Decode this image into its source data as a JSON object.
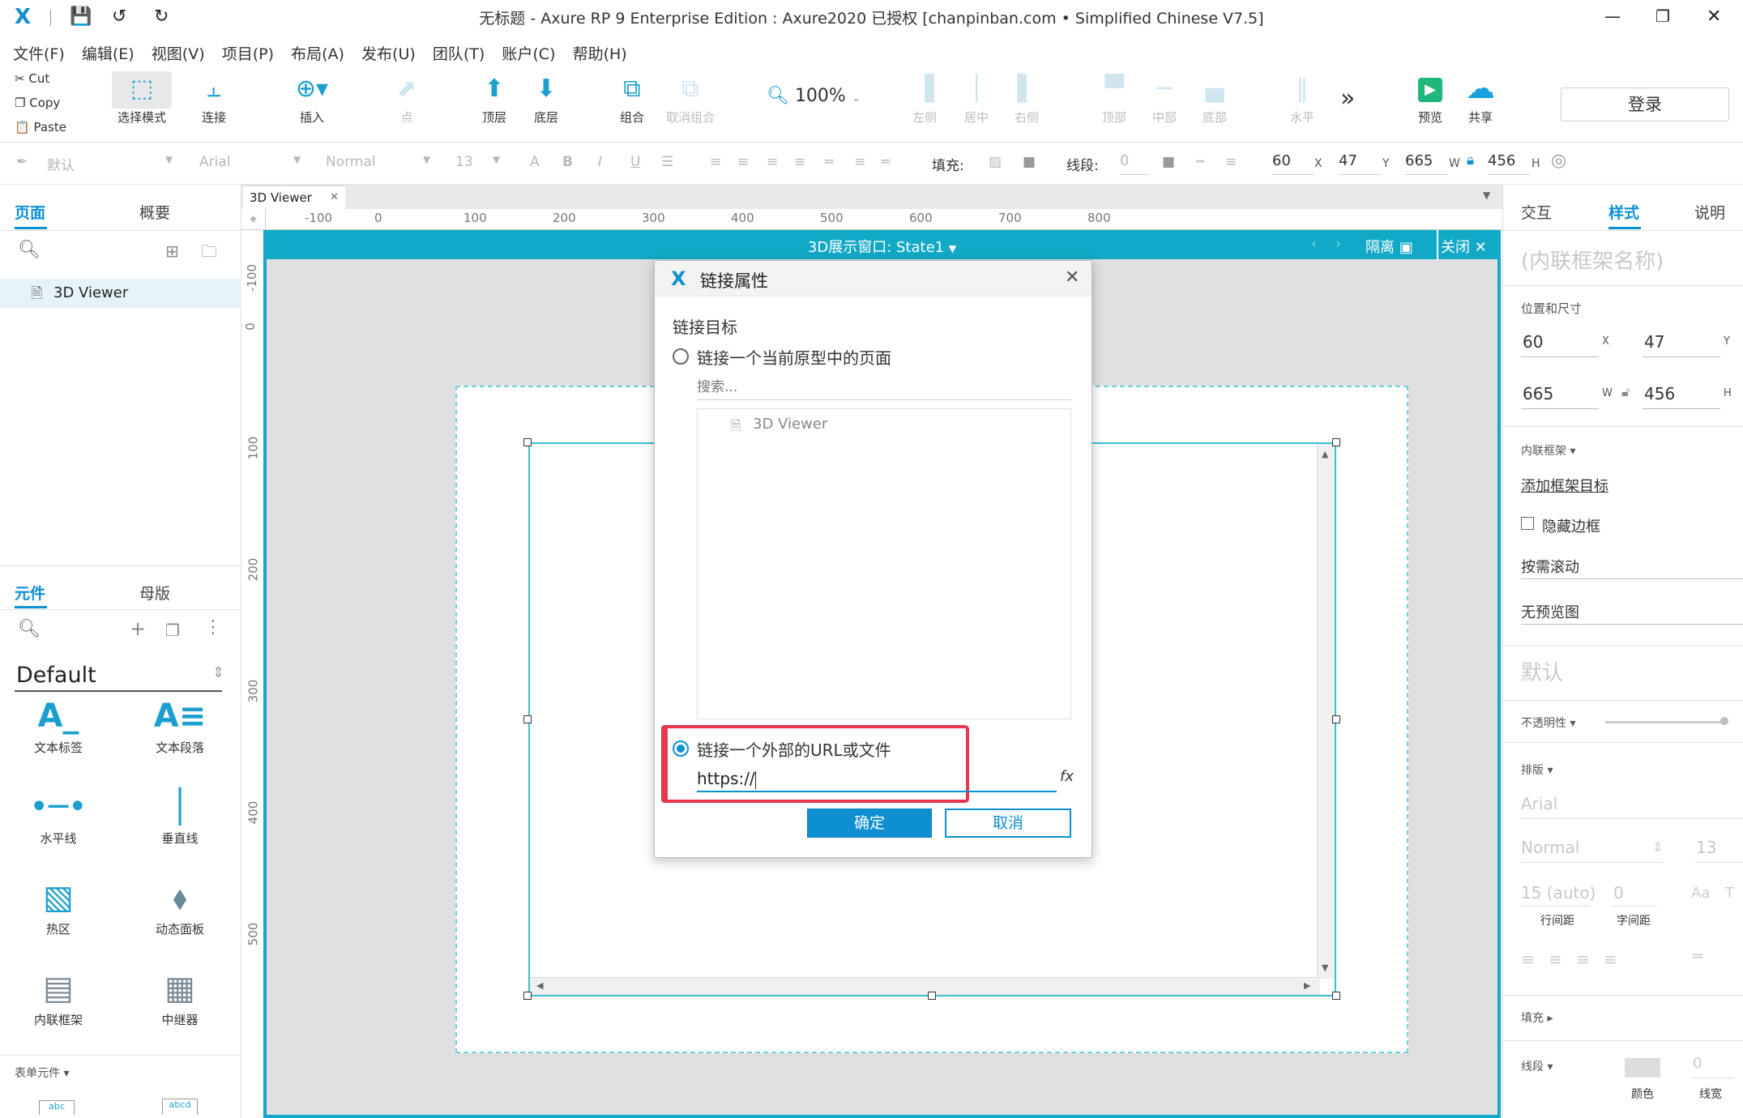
{
  "titlebar": {
    "title": "无标题 - Axure RP 9 Enterprise Edition : Axure2020 已授权    [chanpinban.com • Simplified Chinese V7.5]",
    "logo": "X"
  },
  "menu": [
    "文件(F)",
    "编辑(E)",
    "视图(V)",
    "项目(P)",
    "布局(A)",
    "发布(U)",
    "团队(T)",
    "账户(C)",
    "帮助(H)"
  ],
  "clipboard": {
    "cut": "Cut",
    "copy": "Copy",
    "paste": "Paste"
  },
  "toolbar": {
    "select_mode": "选择模式",
    "connect": "连接",
    "insert": "插入",
    "point": "点",
    "top_layer": "顶层",
    "bottom_layer": "底层",
    "group": "组合",
    "ungroup": "取消组合",
    "zoom": "100%",
    "align_left": "左侧",
    "align_center": "居中",
    "align_right": "右侧",
    "align_top": "顶部",
    "align_middle": "中部",
    "align_bottom": "底部",
    "distribute_h": "水平",
    "more": "»",
    "preview": "预览",
    "share": "共享",
    "login": "登录"
  },
  "formatbar": {
    "style": "默认",
    "font": "Arial",
    "weight": "Normal",
    "size": "13",
    "fill_label": "填充:",
    "stroke_label": "线段:",
    "stroke_value": "0",
    "x": "60",
    "x_unit": "X",
    "y": "47",
    "y_unit": "Y",
    "w": "665",
    "w_unit": "W",
    "h": "456",
    "h_unit": "H"
  },
  "pages_panel": {
    "tab_pages": "页面",
    "tab_outline": "概要",
    "items": [
      {
        "label": "3D Viewer"
      }
    ]
  },
  "widgets_panel": {
    "tab_widgets": "元件",
    "tab_masters": "母版",
    "library": "Default",
    "items": [
      {
        "label": "文本标签",
        "icon": "text-label-icon"
      },
      {
        "label": "文本段落",
        "icon": "text-paragraph-icon"
      },
      {
        "label": "水平线",
        "icon": "horizontal-line-icon"
      },
      {
        "label": "垂直线",
        "icon": "vertical-line-icon"
      },
      {
        "label": "热区",
        "icon": "hotspot-icon"
      },
      {
        "label": "动态面板",
        "icon": "dynamic-panel-icon"
      },
      {
        "label": "内联框架",
        "icon": "inline-frame-icon"
      },
      {
        "label": "中继器",
        "icon": "repeater-icon"
      }
    ],
    "section_form": "表单元件",
    "form_preview_1": "abc",
    "form_preview_2": "abcd"
  },
  "canvas": {
    "doc_tab": "3D Viewer",
    "edit_title": "3D展示窗口: State1",
    "isolate": "隔离",
    "close": "关闭",
    "ruler_h": [
      "-100",
      "0",
      "100",
      "200",
      "300",
      "400",
      "500",
      "600",
      "700",
      "800"
    ],
    "ruler_v": [
      "-100",
      "0",
      "100",
      "200",
      "300",
      "400",
      "500"
    ]
  },
  "dialog": {
    "title": "链接属性",
    "section": "链接目标",
    "option_page": "链接一个当前原型中的页面",
    "search_placeholder": "搜索...",
    "tree_item": "3D Viewer",
    "option_url": "链接一个外部的URL或文件",
    "url_value": "https://",
    "fx": "fx",
    "ok": "确定",
    "cancel": "取消",
    "highlight_color": "#e8384f"
  },
  "right_panel": {
    "tab_interact": "交互",
    "tab_style": "样式",
    "tab_notes": "说明",
    "name_placeholder": "(内联框架名称)",
    "pos_size": "位置和尺寸",
    "x": "60",
    "x_unit": "X",
    "y": "47",
    "y_unit": "Y",
    "w": "665",
    "w_unit": "W",
    "h": "456",
    "h_unit": "H",
    "iframe_section": "内联框架 ▾",
    "add_target": "添加框架目标",
    "hide_border": "隐藏边框",
    "scroll": "按需滚动",
    "no_preview": "无预览图",
    "default_style": "默认",
    "opacity": "不透明性 ▾",
    "typography": "排版 ▾",
    "font": "Arial",
    "weight": "Normal",
    "size": "13",
    "line_height": "15 (auto)",
    "char_spacing": "0",
    "line_height_label": "行间距",
    "char_spacing_label": "字间距",
    "fill": "填充 ▸",
    "stroke": "线段 ▾",
    "stroke_value": "0",
    "color_label": "颜色",
    "stroke_width_label": "线宽"
  }
}
